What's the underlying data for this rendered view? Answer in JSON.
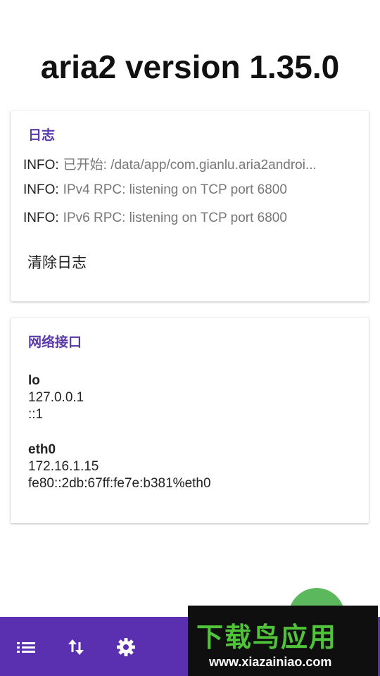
{
  "header": {
    "title": "aria2 version 1.35.0"
  },
  "log_card": {
    "title": "日志",
    "entries": [
      {
        "level": "INFO:",
        "message": "已开始: /data/app/com.gianlu.aria2androi..."
      },
      {
        "level": "INFO:",
        "message": "IPv4 RPC: listening on TCP port 6800"
      },
      {
        "level": "INFO:",
        "message": "IPv6 RPC: listening on TCP port 6800"
      }
    ],
    "clear_label": "清除日志"
  },
  "network_card": {
    "title": "网络接口",
    "interfaces": [
      {
        "name": "lo",
        "addresses": [
          "127.0.0.1",
          "::1"
        ]
      },
      {
        "name": "eth0",
        "addresses": [
          "172.16.1.15",
          "fe80::2db:67ff:fe7e:b381%eth0"
        ]
      }
    ]
  },
  "bottom_nav": {
    "icons": [
      "list-icon",
      "transfer-arrows-icon",
      "settings-gear-icon"
    ]
  },
  "watermark": {
    "main": "下载鸟应用",
    "url": "www.xiazainiao.com"
  },
  "colors": {
    "accent": "#5a3aa8",
    "bar": "#5a2fb0",
    "fab": "#5cb85c"
  }
}
